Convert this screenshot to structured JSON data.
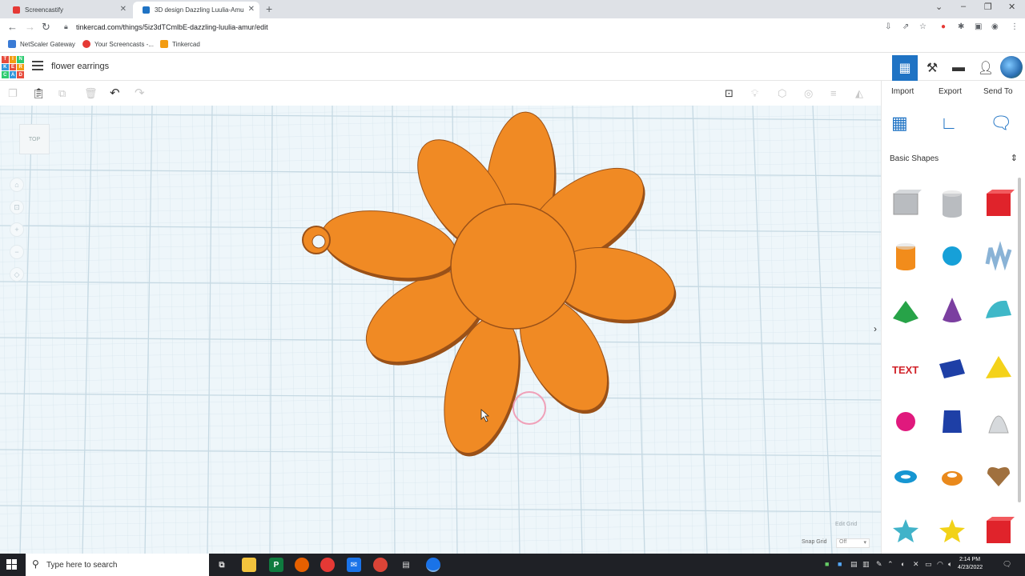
{
  "browser": {
    "tabs": [
      {
        "title": "Screencastify",
        "active": false,
        "favicon_color": "#e53935"
      },
      {
        "title": "3D design Dazzling Luulia-Amu",
        "active": true,
        "favicon_color": "#1f73c4"
      }
    ],
    "url": "tinkercad.com/things/5iz3dTCmlbE-dazzling-luulia-amur/edit",
    "bookmarks": [
      {
        "label": "NetScaler Gateway",
        "icon_color": "#3a7bd5"
      },
      {
        "label": "Your Screencasts -...",
        "icon_color": "#e53935"
      },
      {
        "label": "Tinkercad",
        "icon_color": "#f39c12"
      }
    ]
  },
  "app": {
    "logo_letters": [
      "T",
      "I",
      "N",
      "K",
      "E",
      "R",
      "C",
      "A",
      "D"
    ],
    "logo_colors": [
      "#e74c3c",
      "#f39c12",
      "#2ecc71",
      "#3498db",
      "#e74c3c",
      "#f39c12",
      "#2ecc71",
      "#3498db",
      "#e74c3c"
    ],
    "project_name": "flower earrings",
    "header_buttons": [
      {
        "name": "3d-view-icon",
        "active": true
      },
      {
        "name": "codeblocks-icon",
        "active": false
      },
      {
        "name": "bricks-icon",
        "active": false
      },
      {
        "name": "add-user-icon",
        "active": false
      }
    ]
  },
  "toolbar": {
    "items": [
      "copy-icon",
      "paste-icon",
      "duplicate-icon",
      "delete-icon",
      "undo-icon",
      "redo-icon"
    ],
    "right_items": [
      "note-icon",
      "light-icon",
      "shape-icon",
      "group-icon",
      "align-icon",
      "mirror-icon"
    ]
  },
  "workplane": {
    "view_cube_label": "TOP",
    "edit_grid_label": "Edit Grid",
    "snap_grid_label": "Snap Grid",
    "snap_grid_value": "Off",
    "flower_color": "#f08a24",
    "flower_edge_color": "#9a5118"
  },
  "panel": {
    "import_label": "Import",
    "export_label": "Export",
    "send_to_label": "Send To",
    "category": "Basic Shapes",
    "shapes": [
      {
        "name": "box-hole",
        "color": "#b9bcc0"
      },
      {
        "name": "cylinder-hole",
        "color": "#b9bcc0"
      },
      {
        "name": "box",
        "color": "#e0232b"
      },
      {
        "name": "cylinder",
        "color": "#f28c1b"
      },
      {
        "name": "sphere",
        "color": "#16a0d8"
      },
      {
        "name": "scribble",
        "color": "#8ab3d6"
      },
      {
        "name": "roof",
        "color": "#27a348"
      },
      {
        "name": "cone",
        "color": "#7b3fa0"
      },
      {
        "name": "round-roof",
        "color": "#3fb8c8"
      },
      {
        "name": "text",
        "color": "#d1232a"
      },
      {
        "name": "wedge",
        "color": "#1e3fa6"
      },
      {
        "name": "pyramid",
        "color": "#f4d21a"
      },
      {
        "name": "half-sphere",
        "color": "#e0197d"
      },
      {
        "name": "polygon",
        "color": "#1e3fa6"
      },
      {
        "name": "paraboloid",
        "color": "#d6d9dc"
      },
      {
        "name": "torus",
        "color": "#1696d2"
      },
      {
        "name": "tube",
        "color": "#e9891c"
      },
      {
        "name": "heart",
        "color": "#a0703e"
      },
      {
        "name": "star",
        "color": "#41b3c9"
      },
      {
        "name": "star-yellow",
        "color": "#f2d218"
      },
      {
        "name": "icosahedron",
        "color": "#e0232b"
      }
    ]
  },
  "taskbar": {
    "search_placeholder": "Type here to search",
    "time": "2:14 PM",
    "date": "4/23/2022"
  }
}
